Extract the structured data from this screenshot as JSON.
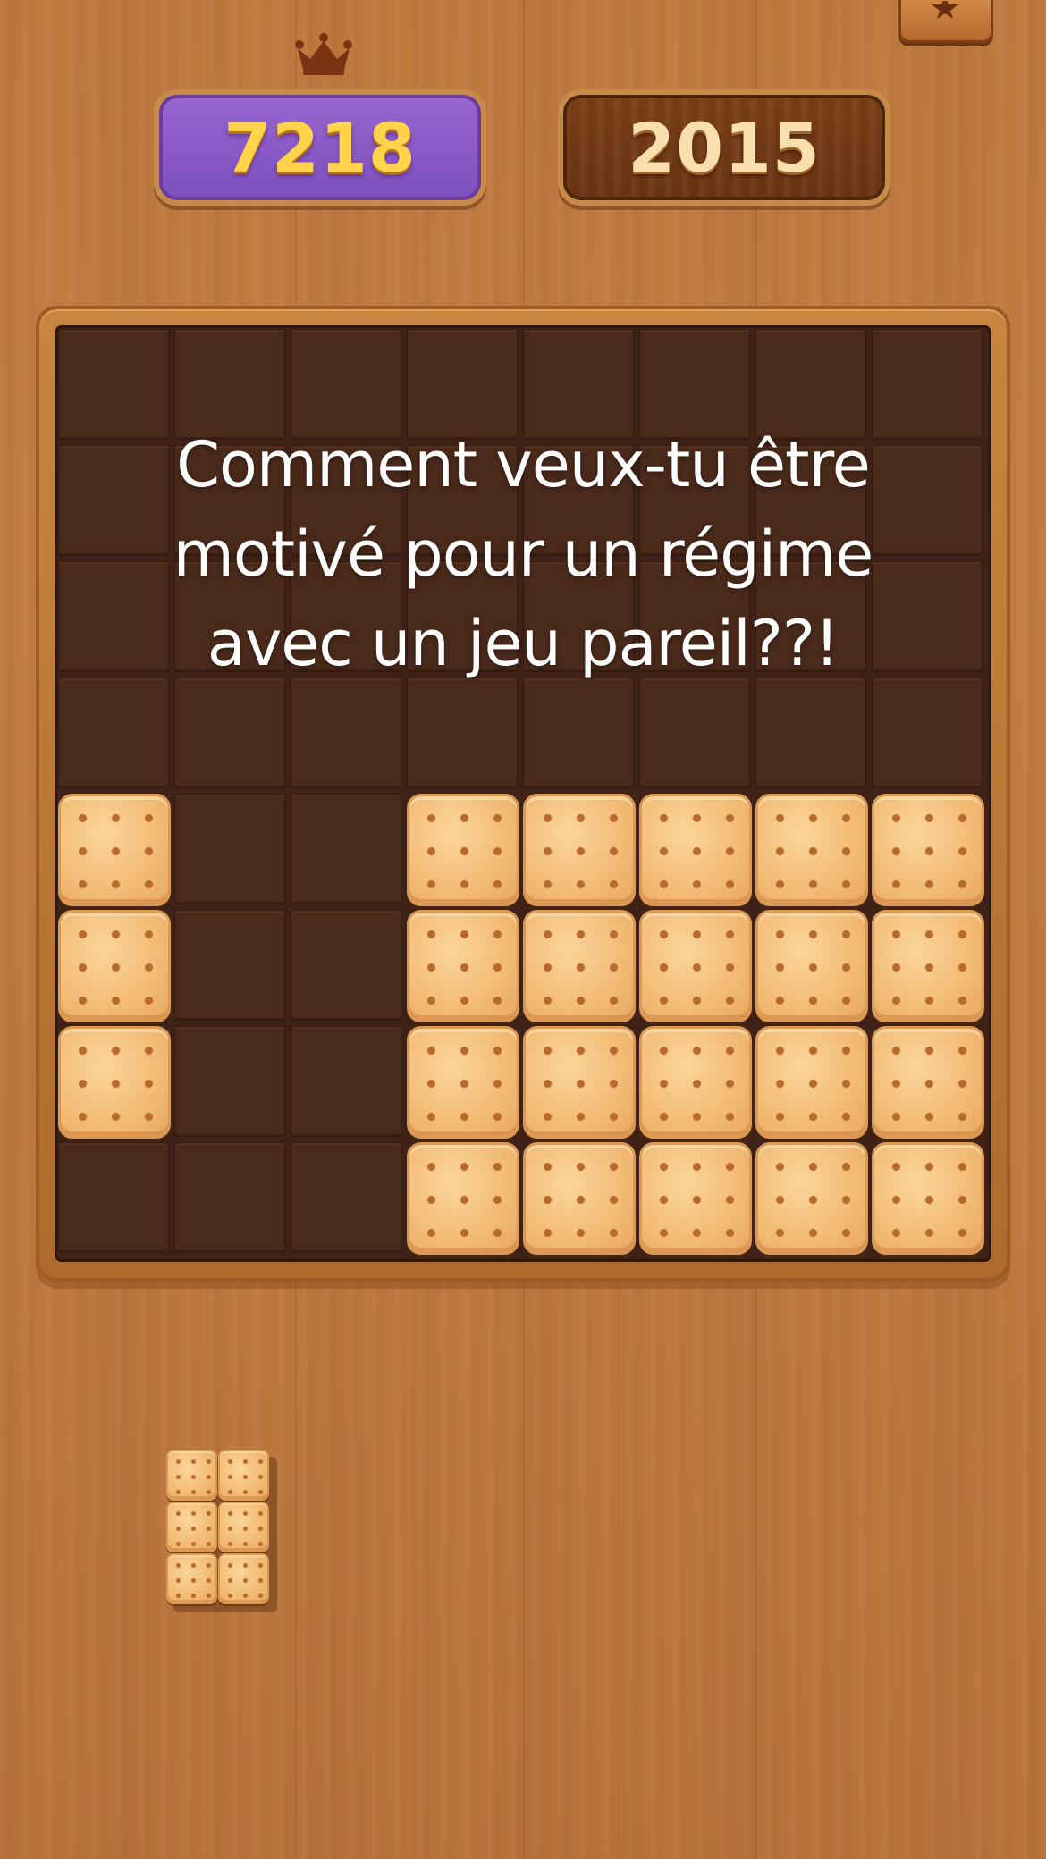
{
  "scores": {
    "best": "7218",
    "current": "2015"
  },
  "icons": {
    "best_score_indicator": "crown-icon",
    "corner_button": "star-icon"
  },
  "colors": {
    "wood_background": "#c07a3e",
    "best_score_panel": "#8a5ac6",
    "best_score_text": "#ffd34a",
    "current_score_panel": "#6f3714",
    "current_score_text": "#f9dfae",
    "board_background": "#4a2a1b",
    "cracker_block": "#f3bd78"
  },
  "board": {
    "columns": 8,
    "rows": 8,
    "grid": [
      "........",
      "........",
      "........",
      "........",
      "X..XXXXX",
      "X..XXXXX",
      "X..XXXXX",
      "...XXXXX"
    ]
  },
  "tray": {
    "pieces": [
      {
        "shape": [
          "XX",
          "XX",
          "XX"
        ]
      }
    ]
  },
  "caption": {
    "lines": [
      "Comment veux-tu être",
      "motivé pour un régime",
      "avec un jeu pareil??!"
    ]
  }
}
